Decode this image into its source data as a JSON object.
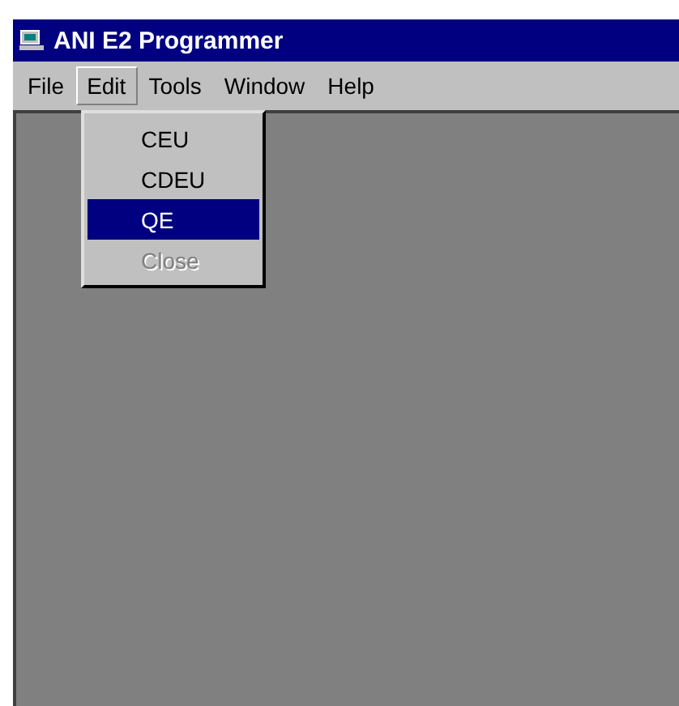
{
  "window": {
    "title": "ANI E2 Programmer"
  },
  "menu_bar": [
    {
      "label": "File",
      "selected": false
    },
    {
      "label": "Edit",
      "selected": true
    },
    {
      "label": "Tools",
      "selected": false
    },
    {
      "label": "Window",
      "selected": false
    },
    {
      "label": "Help",
      "selected": false
    }
  ],
  "edit_menu": [
    {
      "label": "CEU",
      "selected": false,
      "disabled": false
    },
    {
      "label": "CDEU",
      "selected": false,
      "disabled": false
    },
    {
      "label": "QE",
      "selected": true,
      "disabled": false
    },
    {
      "label": "Close",
      "selected": false,
      "disabled": true
    }
  ]
}
